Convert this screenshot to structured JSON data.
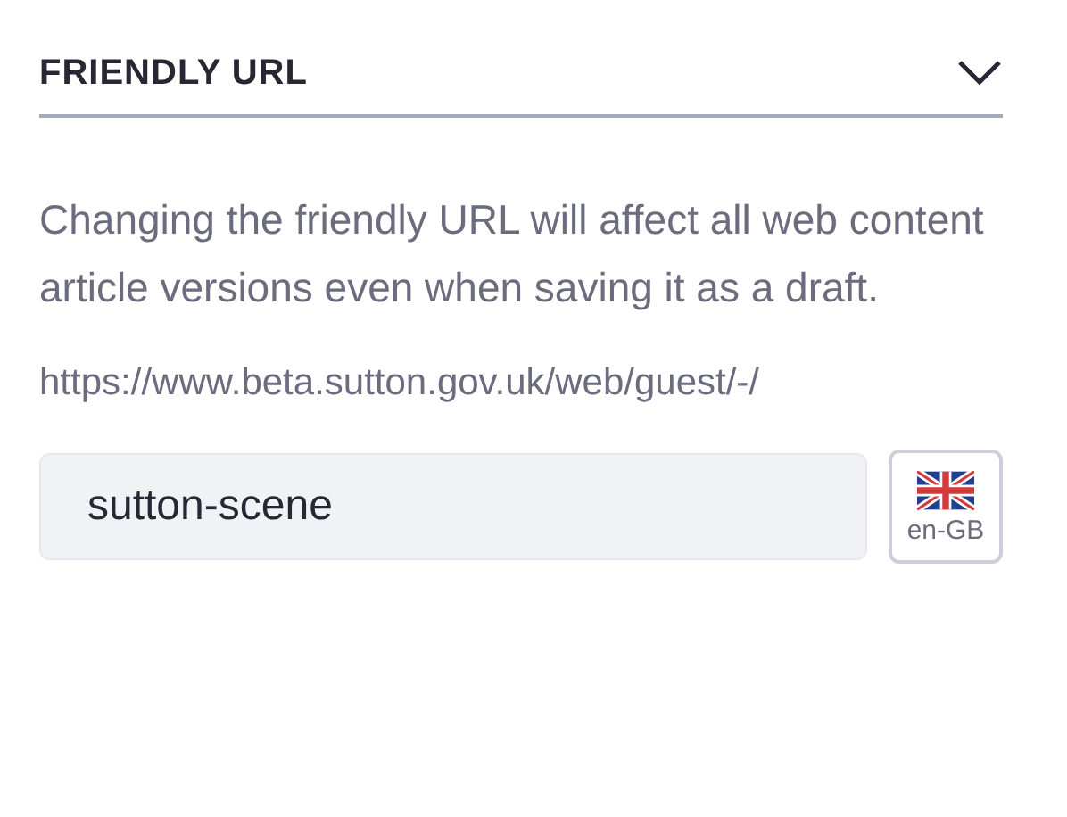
{
  "section": {
    "title": "FRIENDLY URL",
    "expanded": true
  },
  "help_text": "Changing the friendly URL will affect all web content article versions even when saving it as a draft.",
  "url_prefix": "https://www.beta.sutton.gov.uk/web/guest/-/",
  "url_field": {
    "value": "sutton-scene"
  },
  "language_button": {
    "label": "en-GB"
  }
}
